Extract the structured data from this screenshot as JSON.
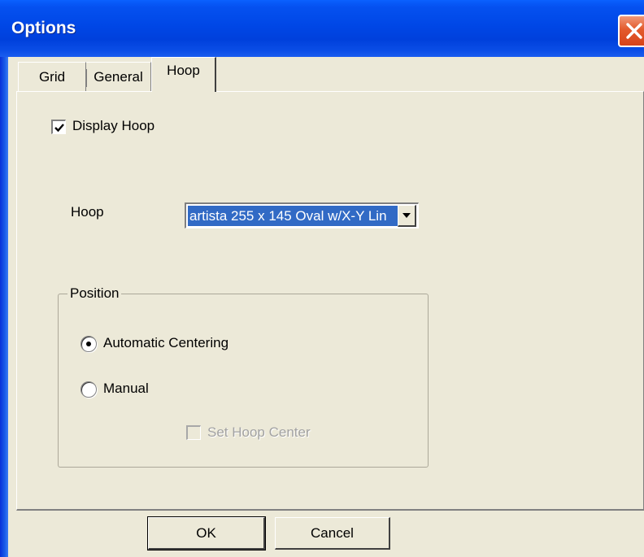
{
  "window": {
    "title": "Options"
  },
  "tabs": [
    {
      "label": "Grid"
    },
    {
      "label": "General"
    },
    {
      "label": "Hoop",
      "selected": true
    }
  ],
  "hoop_tab": {
    "display_hoop": {
      "label": "Display Hoop",
      "checked": true
    },
    "hoop_label": "Hoop",
    "hoop_select": {
      "value": "artista 255 x 145 Oval w/X-Y Lin"
    },
    "position_group": {
      "title": "Position",
      "automatic_centering": {
        "label": "Automatic Centering",
        "selected": true
      },
      "manual": {
        "label": "Manual",
        "selected": false
      },
      "set_hoop_center": {
        "label": "Set Hoop Center",
        "checked": false,
        "disabled": true
      }
    }
  },
  "buttons": {
    "ok": "OK",
    "cancel": "Cancel"
  },
  "colors": {
    "title_bar": "#0047e6",
    "selection": "#316ac5",
    "face": "#ece9d8",
    "close": "#e35a2c"
  },
  "icons": {
    "close": "close-icon",
    "dropdown": "chevron-down-icon",
    "check": "check-icon"
  }
}
